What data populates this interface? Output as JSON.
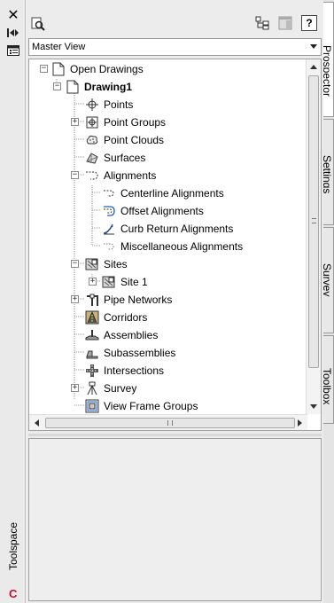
{
  "palette": {
    "title": "Toolspace",
    "close_icon": "close-icon",
    "autohide_icon": "autohide-icon",
    "properties_icon": "properties-icon"
  },
  "toolbar": {
    "search_icon": "search-icon",
    "tool1_icon": "tree-view-icon",
    "tool2_icon": "panel-toggle-icon",
    "help_label": "?"
  },
  "view": {
    "selected": "Master View"
  },
  "tree": {
    "open_drawings": "Open Drawings",
    "drawing": "Drawing1",
    "points": "Points",
    "point_groups": "Point Groups",
    "point_clouds": "Point Clouds",
    "surfaces": "Surfaces",
    "alignments": "Alignments",
    "centerline_alignments": "Centerline Alignments",
    "offset_alignments": "Offset Alignments",
    "curb_return_alignments": "Curb Return Alignments",
    "misc_alignments": "Miscellaneous Alignments",
    "sites": "Sites",
    "site1": "Site 1",
    "pipe_networks": "Pipe Networks",
    "corridors": "Corridors",
    "assemblies": "Assemblies",
    "subassemblies": "Subassemblies",
    "intersections": "Intersections",
    "survey": "Survey",
    "view_frame_groups": "View Frame Groups"
  },
  "tabs": {
    "prospector": "Prospector",
    "settings": "Settings",
    "survey": "Survey",
    "toolbox": "Toolbox"
  },
  "colors": {
    "accent": "#1f5fbf",
    "civil_logo": "#c8102e"
  }
}
